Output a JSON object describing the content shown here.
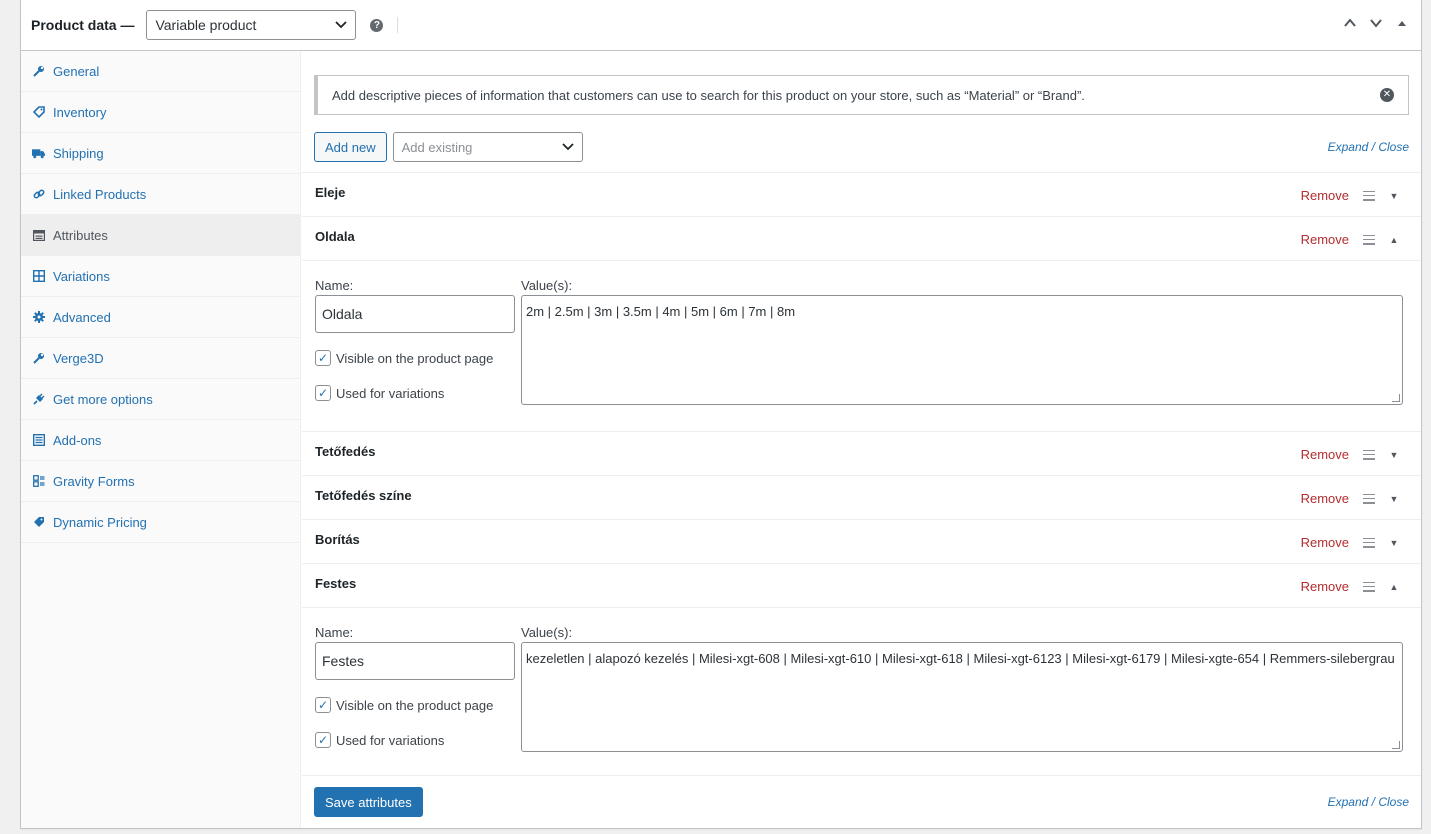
{
  "header": {
    "title": "Product data —",
    "product_type": "Variable product",
    "help_glyph": "?",
    "move_up_glyph": "︿",
    "move_down_glyph": "﹀",
    "toggle_glyph": "▲"
  },
  "tabs": [
    {
      "label": "General",
      "icon": "wrench-icon"
    },
    {
      "label": "Inventory",
      "icon": "tag-icon"
    },
    {
      "label": "Shipping",
      "icon": "truck-icon"
    },
    {
      "label": "Linked Products",
      "icon": "link-icon"
    },
    {
      "label": "Attributes",
      "icon": "list-icon",
      "active": true
    },
    {
      "label": "Variations",
      "icon": "grid-icon"
    },
    {
      "label": "Advanced",
      "icon": "gear-icon"
    },
    {
      "label": "Verge3D",
      "icon": "wrench-icon"
    },
    {
      "label": "Get more options",
      "icon": "plugin-icon"
    },
    {
      "label": "Add-ons",
      "icon": "list-icon"
    },
    {
      "label": "Gravity Forms",
      "icon": "form-icon"
    },
    {
      "label": "Dynamic Pricing",
      "icon": "tag-icon"
    }
  ],
  "notice": {
    "text": "Add descriptive pieces of information that customers can use to search for this product on your store, such as “Material” or “Brand”.",
    "close_glyph": "✕"
  },
  "toolbar": {
    "add_new": "Add new",
    "add_existing_placeholder": "Add existing",
    "expand": "Expand",
    "separator": " / ",
    "close": "Close"
  },
  "attributes": [
    {
      "name": "Eleje",
      "remove": "Remove",
      "expanded": false
    },
    {
      "name": "Oldala",
      "remove": "Remove",
      "expanded": true,
      "name_label": "Name:",
      "values_label": "Value(s):",
      "name_value": "Oldala",
      "values": "2m | 2.5m | 3m | 3.5m | 4m | 5m | 6m | 7m | 8m",
      "visible_label": "Visible on the product page",
      "variations_label": "Used for variations"
    },
    {
      "name": "Tetőfedés",
      "remove": "Remove",
      "expanded": false
    },
    {
      "name": "Tetőfedés színe",
      "remove": "Remove",
      "expanded": false
    },
    {
      "name": "Borítás",
      "remove": "Remove",
      "expanded": false
    },
    {
      "name": "Festes",
      "remove": "Remove",
      "expanded": true,
      "name_label": "Name:",
      "values_label": "Value(s):",
      "name_value": "Festes",
      "values": "kezeletlen | alapozó kezelés | Milesi-xgt-608 | Milesi-xgt-610 | Milesi-xgt-618 | Milesi-xgt-6123 | Milesi-xgt-6179 | Milesi-xgte-654 | Remmers-silebergrau",
      "visible_label": "Visible on the product page",
      "variations_label": "Used for variations"
    }
  ],
  "footer": {
    "save": "Save attributes",
    "expand": "Expand",
    "separator": " / ",
    "close": "Close"
  },
  "colors": {
    "accent": "#2271b1",
    "remove": "#b32d2e",
    "border": "#c3c4c7"
  }
}
